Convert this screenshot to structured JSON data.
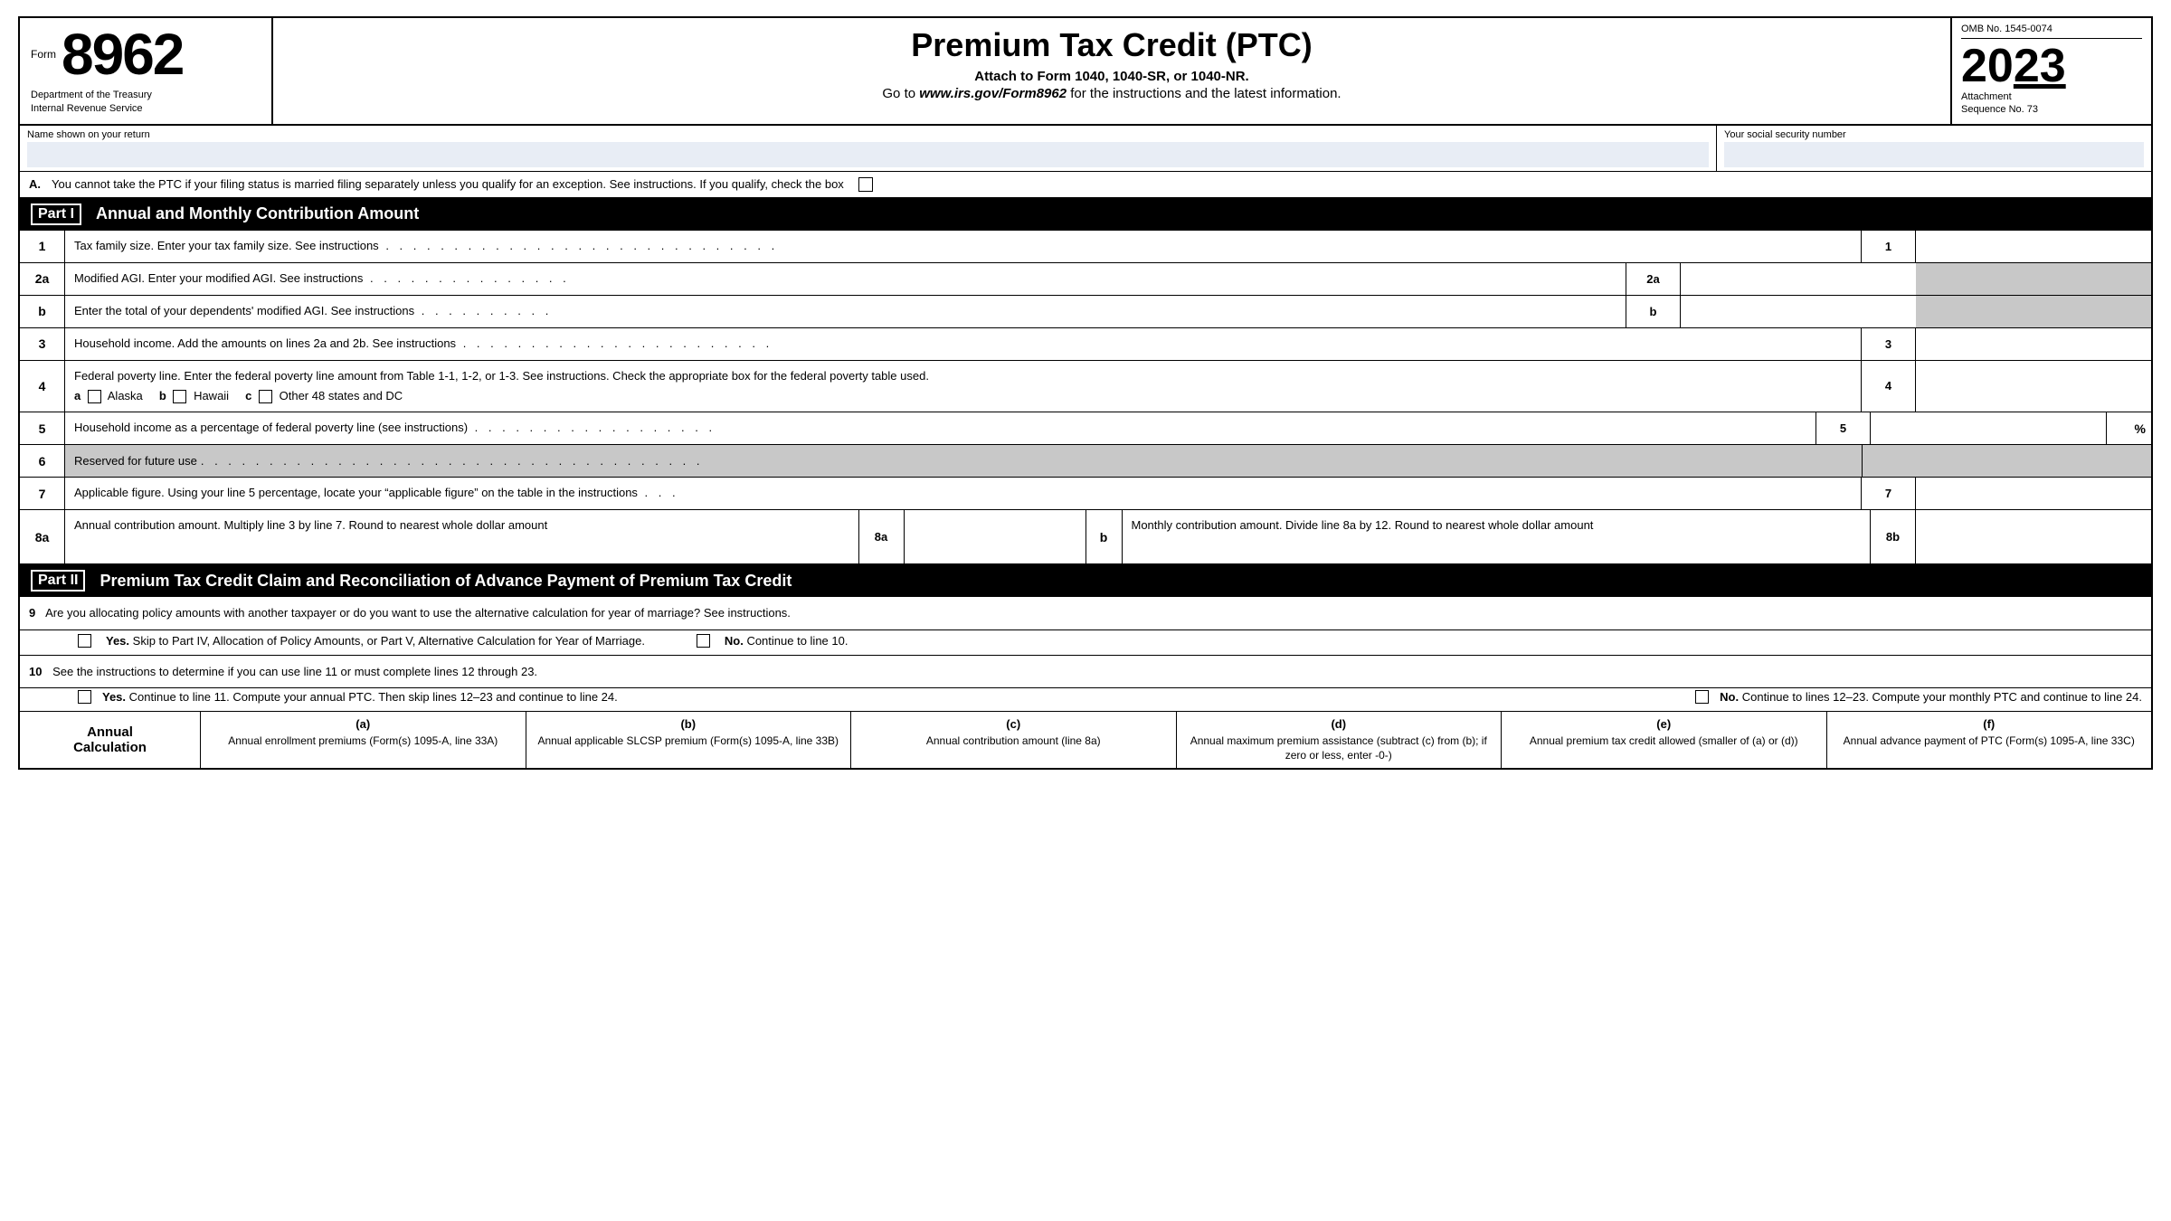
{
  "header": {
    "form_label": "Form",
    "form_number": "8962",
    "title": "Premium Tax Credit (PTC)",
    "attach_line": "Attach to Form 1040, 1040-SR, or 1040-NR.",
    "website_line": "Go to www.irs.gov/Form8962 for the instructions and the latest information.",
    "dept_line1": "Department of the Treasury",
    "dept_line2": "Internal Revenue Service",
    "omb": "OMB No. 1545-0074",
    "year": "2023",
    "year_prefix": "20",
    "year_suffix": "23",
    "attachment": "Attachment",
    "sequence": "Sequence No. 73"
  },
  "fields": {
    "name_label": "Name shown on your return",
    "ssn_label": "Your social security number"
  },
  "section_a": {
    "label": "A.",
    "text": "You cannot take the PTC if your filing status is married filing separately unless you qualify for an exception. See instructions. If you qualify, check the box"
  },
  "part1": {
    "label": "Part I",
    "title": "Annual and Monthly Contribution Amount",
    "lines": {
      "line1_num": "1",
      "line1_desc": "Tax family size. Enter your tax family size. See instructions",
      "line2a_num": "2a",
      "line2a_desc": "Modified AGI. Enter your modified AGI. See instructions",
      "line2b_num": "b",
      "line2b_desc": "Enter the total of your dependents' modified AGI. See instructions",
      "line3_num": "3",
      "line3_desc": "Household income. Add the amounts on lines 2a and 2b. See instructions",
      "line4_num": "4",
      "line4_desc": "Federal poverty line. Enter the federal poverty line amount from Table 1-1, 1-2, or 1-3. See instructions. Check the appropriate box for the federal poverty table used.",
      "line4_a": "a",
      "line4_alaska": "Alaska",
      "line4_b": "b",
      "line4_hawaii": "Hawaii",
      "line4_c": "c",
      "line4_other": "Other 48 states and DC",
      "line5_num": "5",
      "line5_desc": "Household income as a percentage of federal poverty line (see instructions)",
      "line5_pct": "%",
      "line6_num": "6",
      "line6_desc": "Reserved for future use",
      "line7_num": "7",
      "line7_desc": "Applicable figure. Using your line 5 percentage, locate your “applicable figure” on the table in the instructions",
      "line8a_num": "8a",
      "line8a_desc": "Annual contribution amount. Multiply line 3 by line 7. Round to nearest whole dollar amount",
      "line8b_label": "b",
      "line8b_desc": "Monthly contribution amount. Divide line 8a by 12. Round to nearest whole dollar amount",
      "line8b_num": "8b"
    }
  },
  "part2": {
    "label": "Part II",
    "title": "Premium Tax Credit Claim and Reconciliation of Advance Payment of Premium Tax Credit",
    "line9_num": "9",
    "line9_desc": "Are you allocating policy amounts with another taxpayer or do you want to use the alternative calculation for year of marriage? See instructions.",
    "line9_yes": "Yes.",
    "line9_yes_note": "Skip to Part IV, Allocation of Policy Amounts, or Part V, Alternative Calculation for Year of Marriage.",
    "line9_no": "No.",
    "line9_no_note": "Continue to line 10.",
    "line10_num": "10",
    "line10_desc": "See the instructions to determine if you can use line 11 or must complete lines 12 through 23.",
    "line10_yes": "Yes.",
    "line10_yes_note": "Continue to line 11. Compute your annual PTC. Then skip lines 12–23 and continue to line 24.",
    "line10_no": "No.",
    "line10_no_note": "Continue to lines 12–23. Compute your monthly PTC and continue to line 24."
  },
  "table": {
    "annual_calc": "Annual\nCalculation",
    "col_a_label": "(a)",
    "col_a_title": "Annual enrollment premiums (Form(s) 1095-A, line 33A)",
    "col_b_label": "(b)",
    "col_b_title": "Annual applicable SLCSP premium (Form(s) 1095-A, line 33B)",
    "col_c_label": "(c)",
    "col_c_title": "Annual contribution amount (line 8a)",
    "col_d_label": "(d)",
    "col_d_title": "Annual maximum premium assistance (subtract (c) from (b); if zero or less, enter -0-)",
    "col_e_label": "(e)",
    "col_e_title": "Annual premium tax credit allowed (smaller of (a) or (d))",
    "col_f_label": "(f)",
    "col_f_title": "Annual advance payment of PTC (Form(s) 1095-A, line 33C)"
  }
}
